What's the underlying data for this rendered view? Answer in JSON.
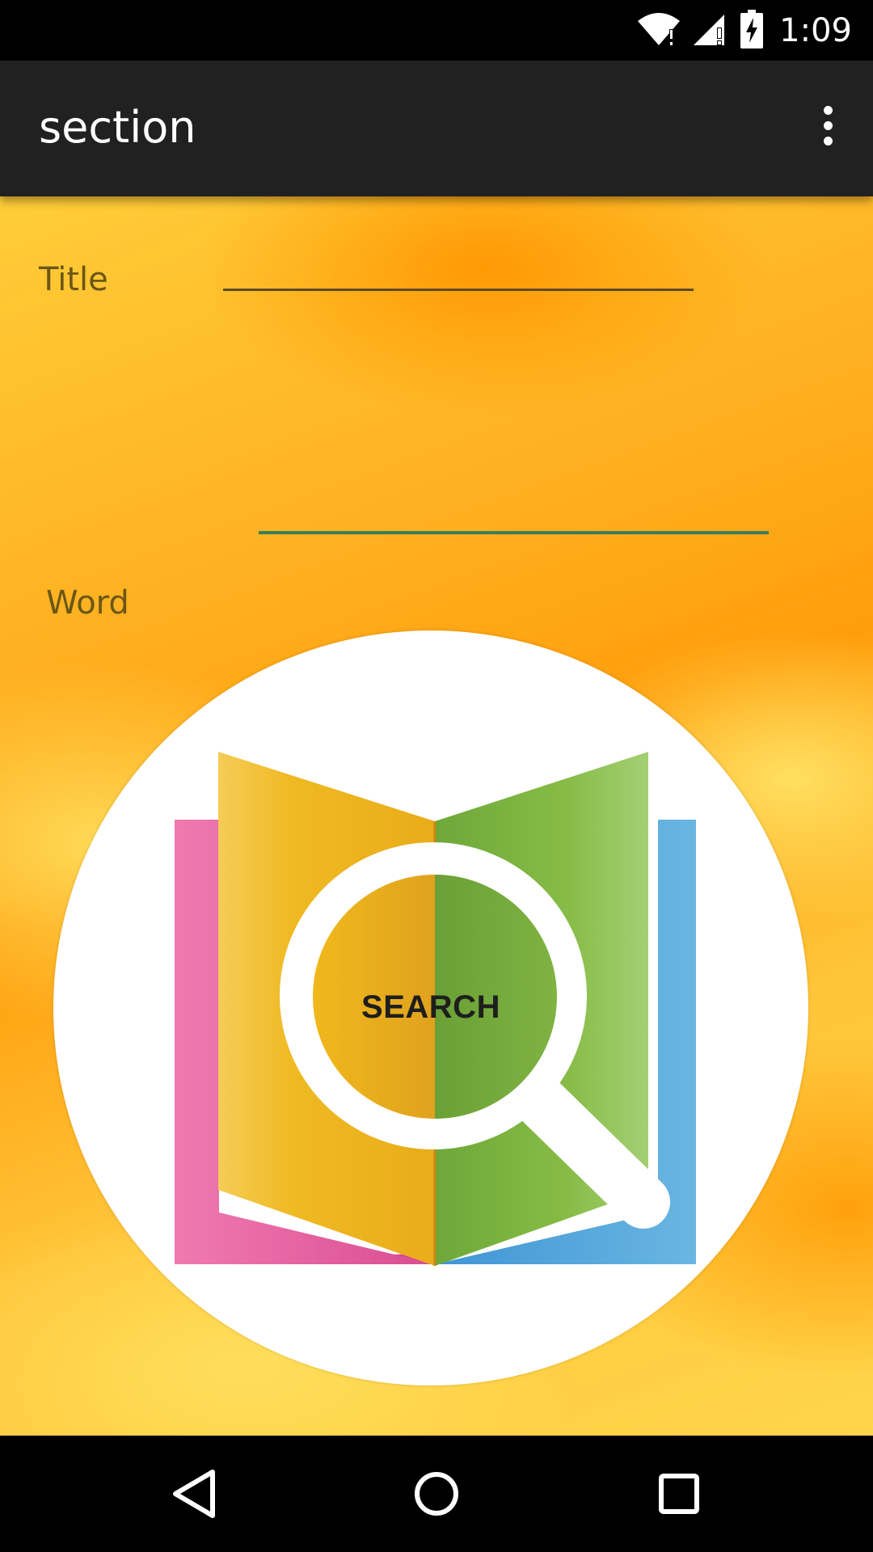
{
  "status_bar": {
    "time": "1:09",
    "icons": [
      "wifi-icon",
      "cell-signal-icon",
      "battery-charging-icon"
    ]
  },
  "app_bar": {
    "title": "section",
    "overflow_icon": "more-vert-icon"
  },
  "form": {
    "title_label": "Title",
    "title_value": "",
    "word_label": "Word",
    "word_value": ""
  },
  "search_button": {
    "label": "SEARCH",
    "icon": "book-magnifier-icon"
  },
  "nav_bar": {
    "icons": [
      "back-icon",
      "home-icon",
      "recents-icon"
    ]
  },
  "colors": {
    "app_bar": "#212121",
    "status_bar": "#000000",
    "accent_underline": "#3a7d5a",
    "label_text": "#6b5616",
    "background_orange": "#ffa514",
    "background_yellow": "#ffd54a"
  }
}
